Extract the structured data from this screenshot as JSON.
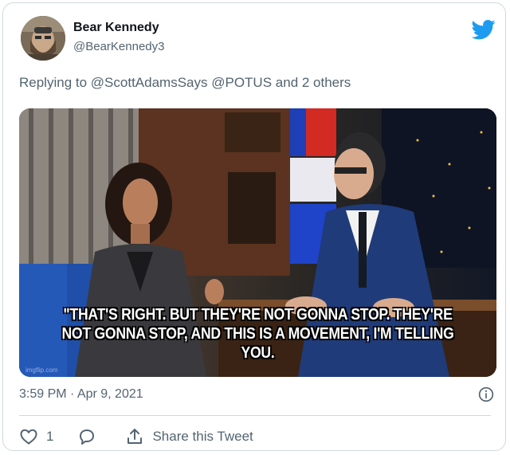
{
  "author": {
    "display_name": "Bear Kennedy",
    "handle": "@BearKennedy3"
  },
  "reply_context": {
    "prefix": "Replying to",
    "mentions": "@ScottAdamsSays @POTUS",
    "suffix": "and 2 others"
  },
  "media": {
    "caption_line1": "\"That's right. But they're not gonna stop. They're",
    "caption_line2": "not gonna stop, and this is a movement, I'm telling you.",
    "watermark": "imgflip.com"
  },
  "timestamp": "3:59 PM · Apr 9, 2021",
  "actions": {
    "like_count": "1",
    "share_label": "Share this Tweet"
  },
  "colors": {
    "brand": "#1d9bf0",
    "muted_text": "#536471",
    "border": "#cfd9de"
  }
}
